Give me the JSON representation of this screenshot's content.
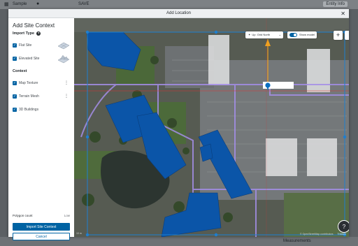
{
  "app": {
    "tab1": "Sample",
    "tab2": "SAVE",
    "right_button": "Entity Info",
    "bottom_label": "Measurements"
  },
  "modal": {
    "title": "Add Location",
    "close_icon": "close-icon"
  },
  "sidebar": {
    "heading": "Add Site Context",
    "import_type_label": "Import Type",
    "import_types": [
      {
        "label": "Flat Site",
        "checked": true
      },
      {
        "label": "Elevated Site",
        "checked": true
      }
    ],
    "context_label": "Context",
    "context_items": [
      {
        "label": "Map Texture",
        "checked": true
      },
      {
        "label": "Terrain Mesh",
        "checked": true
      },
      {
        "label": "3D Buildings",
        "checked": true
      }
    ],
    "polygon_count_label": "Polygon count",
    "polygon_count_value": "Low",
    "import_button": "Import Site Context",
    "cancel_button": "Cancel"
  },
  "map": {
    "compass_label": "Up: Grid North",
    "show_model_label": "Show model",
    "show_model_on": true,
    "zoom_in": "+",
    "zoom_out": "−",
    "help_fab": "?",
    "attribution": "© OpenStreetMap contributors",
    "attribution_brand": "Trimble",
    "scale_label": "10 m",
    "colors": {
      "building": "#0b55a8",
      "selection": "#1e7fd0",
      "path": "#a48ee8",
      "marker": "#f0a020"
    }
  }
}
